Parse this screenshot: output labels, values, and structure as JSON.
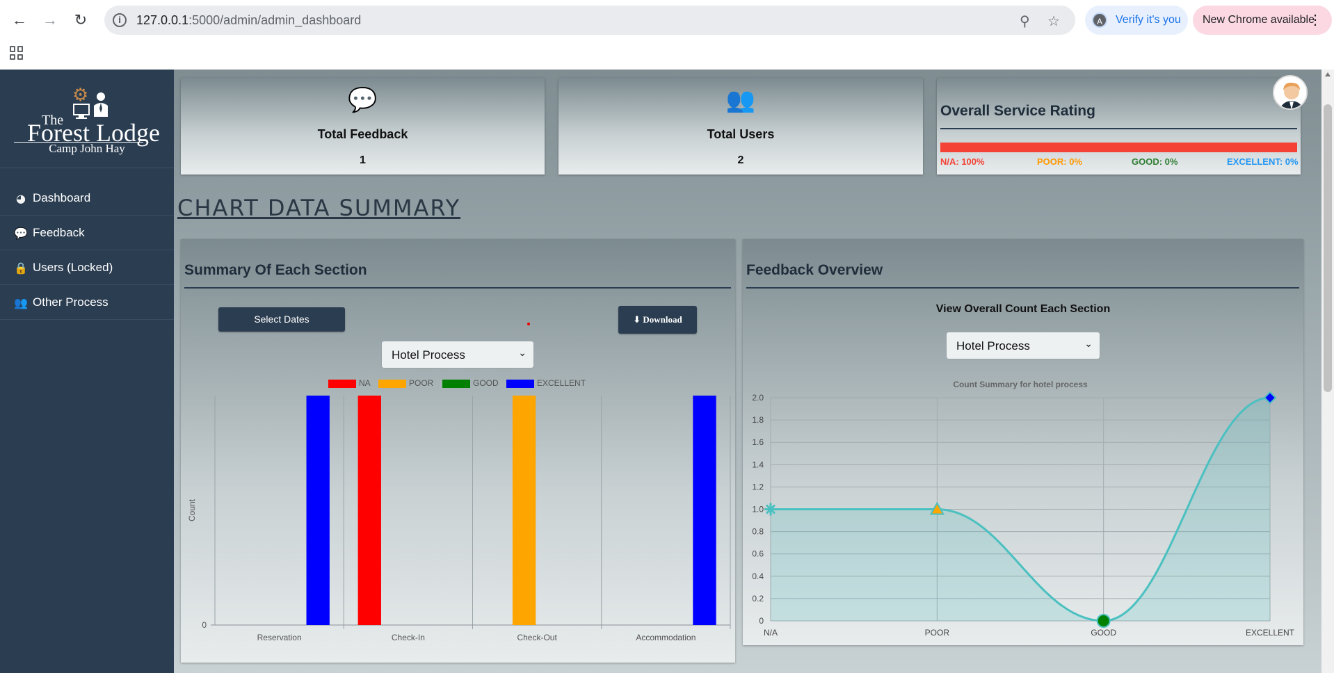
{
  "browser": {
    "url_host": "127.0.0.1",
    "url_rest": ":5000/admin/admin_dashboard",
    "verify_label": "Verify it's you",
    "verify_avatar_letter": "A",
    "new_chrome_label": "New Chrome available"
  },
  "sidebar": {
    "logo": {
      "the": "The",
      "name": "Forest Lodge",
      "sub": "Camp John Hay"
    },
    "items": [
      {
        "label": "Dashboard",
        "icon": "gauge-icon"
      },
      {
        "label": "Feedback",
        "icon": "comments-icon"
      },
      {
        "label": "Users (Locked)",
        "icon": "lock-icon"
      },
      {
        "label": "Other Process",
        "icon": "users-icon"
      }
    ]
  },
  "stats": {
    "feedback": {
      "title": "Total Feedback",
      "value": "1"
    },
    "users": {
      "title": "Total Users",
      "value": "2"
    }
  },
  "rating": {
    "title": "Overall Service Rating",
    "na_fraction": 1.0,
    "labels": {
      "na": "N/A: 100%",
      "poor": "POOR: 0%",
      "good": "GOOD: 0%",
      "excellent": "EXCELLENT: 0%"
    },
    "colors": {
      "na": "#f44336",
      "poor": "#ff9800",
      "good": "#2e7d32",
      "excellent": "#2196f3"
    }
  },
  "heading": "CHART DATA SUMMARY",
  "summary_panel": {
    "title": "Summary Of Each Section",
    "select_dates": "Select Dates",
    "download": "Download",
    "dropdown": "Hotel Process"
  },
  "overview_panel": {
    "title": "Feedback Overview",
    "subtitle": "View Overall Count Each Section",
    "dropdown": "Hotel Process"
  },
  "chart_data": [
    {
      "type": "bar",
      "title": "",
      "ylabel": "Count",
      "xlabel": "",
      "categories": [
        "Reservation",
        "Check-In",
        "Check-Out",
        "Accommodation"
      ],
      "series": [
        {
          "name": "NA",
          "color": "#ff0000",
          "values": [
            0,
            1,
            0,
            0
          ]
        },
        {
          "name": "POOR",
          "color": "#ffa500",
          "values": [
            0,
            0,
            1,
            0
          ]
        },
        {
          "name": "GOOD",
          "color": "#008000",
          "values": [
            0,
            0,
            0,
            0
          ]
        },
        {
          "name": "EXCELLENT",
          "color": "#0000ff",
          "values": [
            1,
            0,
            0,
            1
          ]
        }
      ],
      "ylim": [
        0,
        1
      ],
      "yticks": [
        "0"
      ]
    },
    {
      "type": "line",
      "title": "Count Summary for hotel process",
      "categories": [
        "N/A",
        "POOR",
        "GOOD",
        "EXCELLENT"
      ],
      "values": [
        1,
        1,
        0,
        2
      ],
      "ylim": [
        0,
        2
      ],
      "yticks": [
        "0",
        "0.2",
        "0.4",
        "0.6",
        "0.8",
        "1.0",
        "1.2",
        "1.4",
        "1.6",
        "1.8",
        "2.0"
      ],
      "line_color": "#4bc0c0",
      "fill": true,
      "point_styles": [
        "star",
        "triangle",
        "circle",
        "rectRot"
      ],
      "point_colors": [
        "#4bc0c0",
        "#ffa500",
        "#008000",
        "#0000ff"
      ]
    }
  ]
}
